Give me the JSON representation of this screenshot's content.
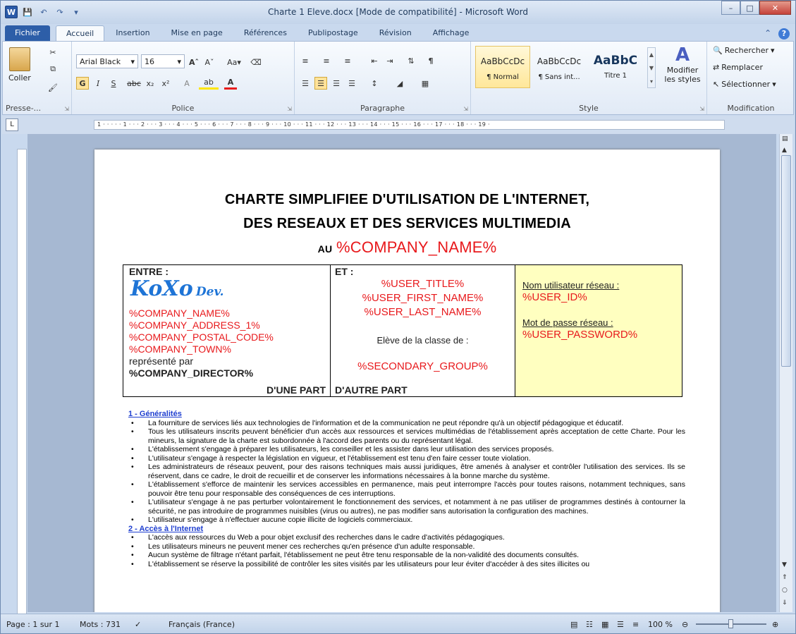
{
  "window": {
    "title": "Charte 1 Eleve.docx [Mode de compatibilité]  -  Microsoft Word",
    "qat_logo": "W"
  },
  "tabs": [
    "Fichier",
    "Accueil",
    "Insertion",
    "Mise en page",
    "Références",
    "Publipostage",
    "Révision",
    "Affichage"
  ],
  "ribbon": {
    "clipboard": {
      "paste_label": "Coller",
      "group_label": "Presse-..."
    },
    "font": {
      "font_name": "Arial Black",
      "font_size": "16",
      "group_label": "Police"
    },
    "paragraph": {
      "group_label": "Paragraphe"
    },
    "styles": {
      "group_label": "Style",
      "items": [
        {
          "preview": "AaBbCcDc",
          "name": "¶ Normal"
        },
        {
          "preview": "AaBbCcDc",
          "name": "¶ Sans int..."
        },
        {
          "preview": "AaBbC",
          "name": "Titre 1"
        }
      ],
      "modify_label_1": "Modifier",
      "modify_label_2": "les styles"
    },
    "editing": {
      "group_label": "Modification",
      "find": "Rechercher",
      "replace": "Remplacer",
      "select": "Sélectionner"
    }
  },
  "ruler": {
    "text": "1 · · · · · 1 · · · 2 · · · 3 · · · 4 · · · 5 · · · 6 · · · 7 · · · 8 · · · 9 · · · 10 · · · 11 · · · 12 · · · 13 · · · 14 · · · 15 · · · 16 · · · 17 · · · 18 · · · 19 ·"
  },
  "document": {
    "title_line1": "CHARTE SIMPLIFIEE D'UTILISATION DE L'INTERNET,",
    "title_line2": "DES RESEAUX ET DES SERVICES MULTIMEDIA",
    "title_au": "AU",
    "title_company": "%COMPANY_NAME%",
    "left": {
      "heading": "ENTRE :",
      "logo_main": "KoXo",
      "logo_sub": "Dev.",
      "lines": [
        "%COMPANY_NAME%",
        "%COMPANY_ADDRESS_1%",
        "%COMPANY_POSTAL_CODE%",
        "%COMPANY_TOWN%"
      ],
      "represented": "représenté par",
      "director": "%COMPANY_DIRECTOR%",
      "footer": "D'UNE PART"
    },
    "middle": {
      "heading": "ET :",
      "lines": [
        "%USER_TITLE%",
        "%USER_FIRST_NAME%",
        "%USER_LAST_NAME%"
      ],
      "class_label": "Elève de la classe de :",
      "group": "%SECONDARY_GROUP%",
      "footer": "D'AUTRE PART"
    },
    "right": {
      "user_label": "Nom utilisateur réseau :",
      "user_value": "%USER_ID%",
      "pass_label": "Mot de passe réseau :",
      "pass_value": "%USER_PASSWORD%"
    },
    "section1": {
      "title": "1 - Généralités",
      "items": [
        "La fourniture de services liés aux technologies de l'information et de la communication ne peut répondre qu'à un objectif pédagogique et éducatif.",
        "Tous les utilisateurs inscrits peuvent bénéficier d'un accès aux ressources et services multimédias de l'établissement après acceptation de cette Charte. Pour les mineurs, la signature de la charte est subordonnée à l'accord des parents ou du représentant légal.",
        "L'établissement s'engage à préparer les utilisateurs, les conseiller et les assister dans leur utilisation des services proposés.",
        "L'utilisateur s'engage à respecter la législation en vigueur, et l'établissement est tenu d'en faire cesser toute violation.",
        "Les administrateurs de réseaux peuvent, pour des raisons techniques mais aussi juridiques, être amenés à analyser et contrôler l'utilisation des services. Ils se réservent, dans ce cadre, le droit de recueillir et de conserver les informations nécessaires à la bonne marche du système.",
        "L'établissement s'efforce de maintenir les services accessibles en permanence, mais peut interrompre l'accès pour toutes raisons, notamment techniques, sans pouvoir être tenu pour responsable des conséquences de ces interruptions.",
        "L'utilisateur s'engage à ne pas perturber volontairement le fonctionnement des services, et notamment à ne pas utiliser de programmes destinés à contourner la sécurité, ne pas introduire de programmes nuisibles (virus ou autres), ne pas modifier sans autorisation la configuration des machines.",
        "L'utilisateur s'engage à n'effectuer aucune copie illicite de logiciels commerciaux."
      ]
    },
    "section2": {
      "title": "2 - Accès à l'Internet",
      "items": [
        "L'accès aux ressources du Web a pour objet exclusif des recherches dans le cadre d'activités pédagogiques.",
        "Les utilisateurs mineurs ne peuvent mener ces recherches qu'en présence d'un adulte responsable.",
        "Aucun système de filtrage n'étant parfait, l'établissement ne peut être tenu responsable de la non-validité des documents consultés.",
        "L'établissement se réserve la possibilité de contrôler les sites visités par les utilisateurs pour leur éviter d'accéder à des sites illicites ou"
      ]
    }
  },
  "statusbar": {
    "page": "Page : 1 sur 1",
    "words": "Mots : 731",
    "language": "Français (France)",
    "zoom": "100 %"
  },
  "colors": {
    "placeholder_red": "#e8191c",
    "link_blue": "#1f3fd0",
    "right_cell_bg": "#ffffc0"
  }
}
